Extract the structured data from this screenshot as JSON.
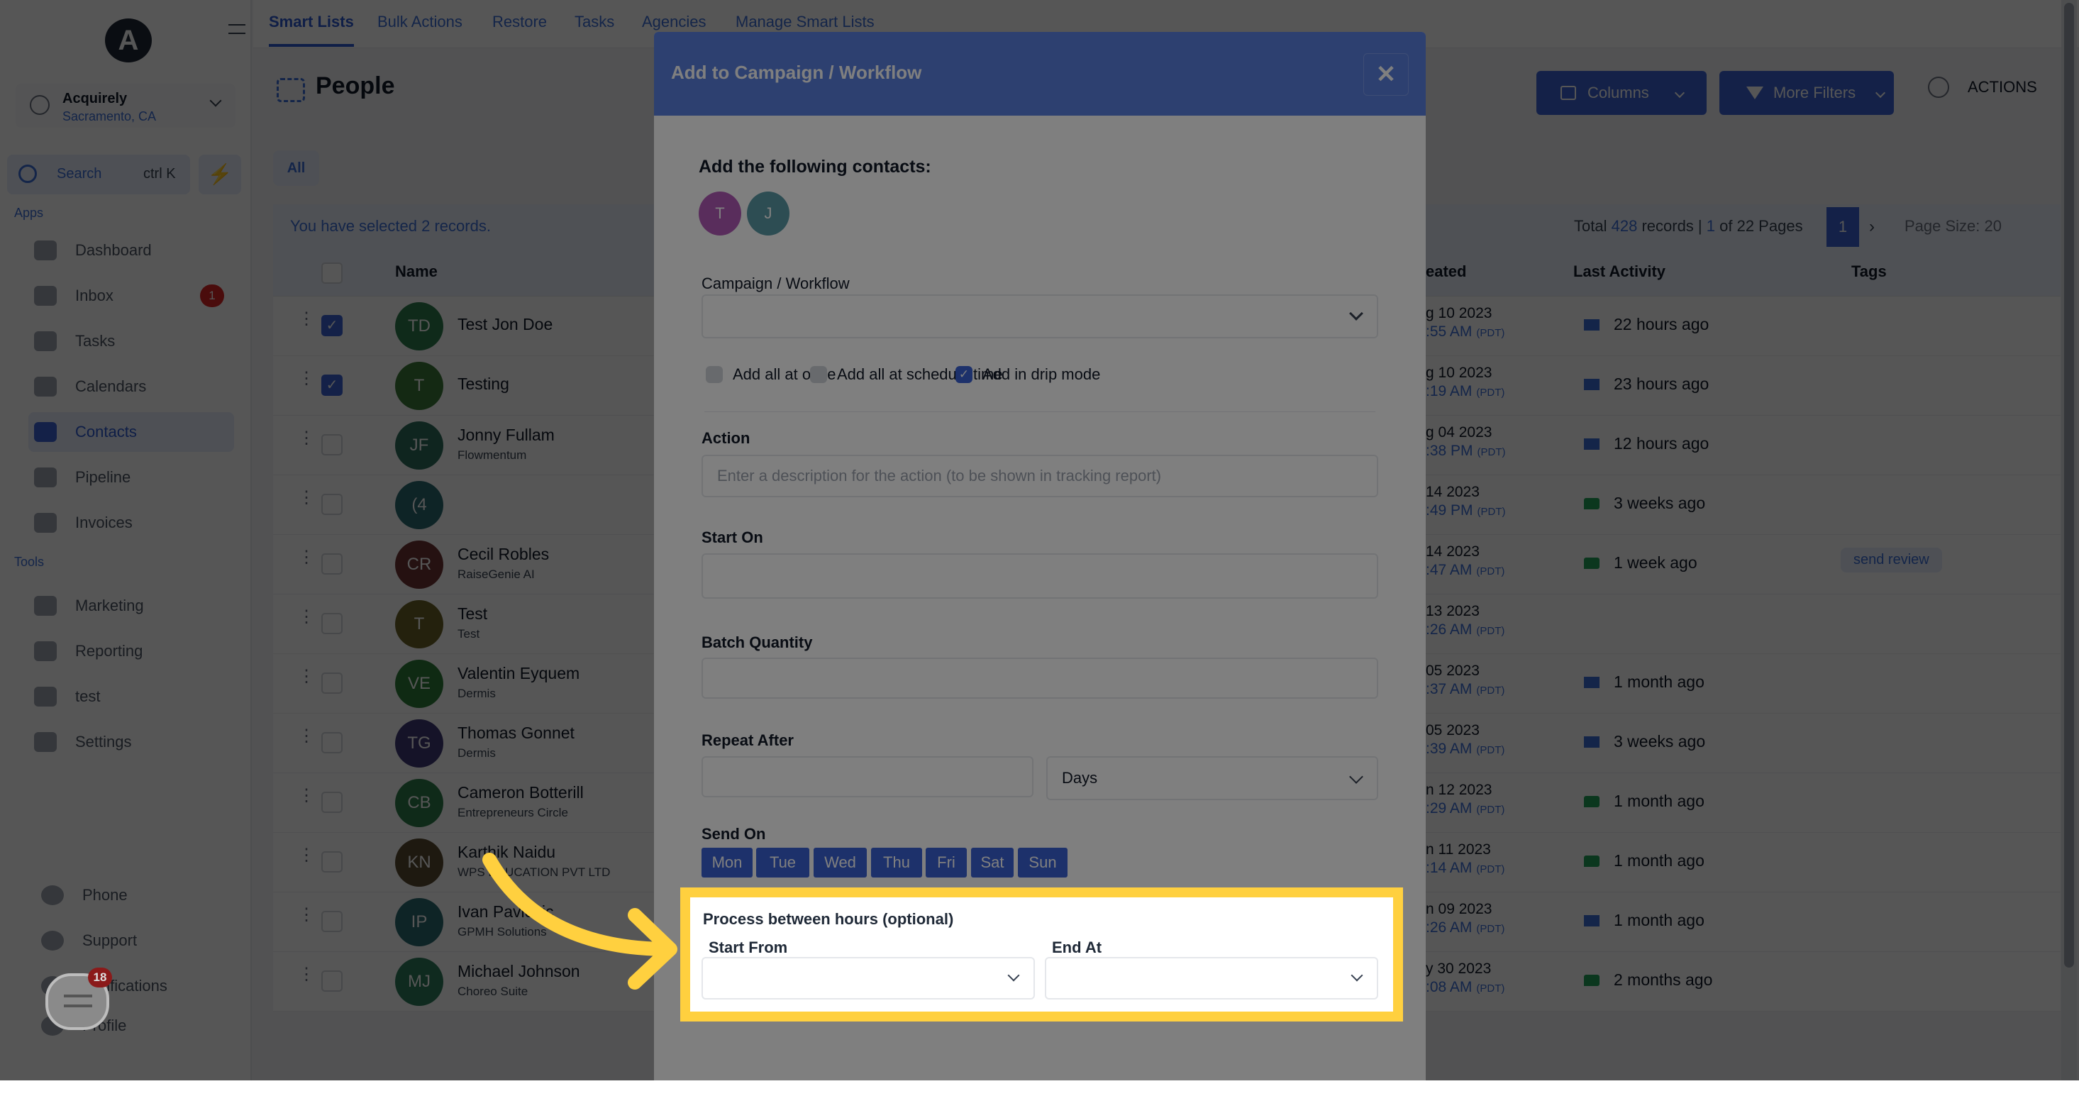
{
  "app": {
    "account": {
      "name": "Acquirely",
      "location": "Sacramento, CA"
    },
    "search": {
      "placeholder": "Search",
      "shortcut": "ctrl K"
    },
    "sidebar": {
      "apps_label": "Apps",
      "tools_label": "Tools",
      "items": [
        {
          "label": "Dashboard",
          "icon": "dashboard-icon"
        },
        {
          "label": "Inbox",
          "icon": "inbox-icon",
          "badge": "1"
        },
        {
          "label": "Tasks",
          "icon": "tasks-icon"
        },
        {
          "label": "Calendars",
          "icon": "calendar-icon"
        },
        {
          "label": "Contacts",
          "icon": "contacts-icon",
          "active": true
        },
        {
          "label": "Pipeline",
          "icon": "pipeline-icon"
        },
        {
          "label": "Invoices",
          "icon": "invoice-icon"
        }
      ],
      "tools": [
        {
          "label": "Marketing",
          "icon": "megaphone-icon"
        },
        {
          "label": "Reporting",
          "icon": "chart-icon"
        },
        {
          "label": "test",
          "icon": "accessibility-icon"
        },
        {
          "label": "Settings",
          "icon": "gear-icon"
        }
      ],
      "bottom": [
        {
          "label": "Phone",
          "icon": "phone-icon"
        },
        {
          "label": "Support",
          "icon": "support-icon"
        },
        {
          "label": "Notifications",
          "icon": "bell-icon"
        },
        {
          "label": "Profile",
          "icon": "profile-icon"
        }
      ],
      "chat_badge": "18"
    },
    "tabs": [
      "Smart Lists",
      "Bulk Actions",
      "Restore",
      "Tasks",
      "Agencies",
      "Manage Smart Lists"
    ],
    "page_title": "People",
    "filter_chip": "All",
    "toolbar": {
      "columns": "Columns",
      "more_filters": "More Filters",
      "actions": "ACTIONS"
    },
    "selection_text": "You have selected 2 records.",
    "pagination": {
      "total_prefix": "Total",
      "total": "428",
      "records_label": "records |",
      "page": "1",
      "of_pages": "of 22 Pages",
      "current_page": "1",
      "page_size": "Page Size: 20"
    },
    "columns": {
      "name": "Name",
      "created": "eated",
      "last_activity": "Last Activity",
      "tags": "Tags"
    },
    "rows": [
      {
        "initials": "TD",
        "color": "#2e7d4f",
        "name": "Test Jon Doe",
        "sub": "",
        "date": "g 10 2023",
        "time": ":55 AM",
        "activity_type": "email",
        "activity": "22 hours ago",
        "checked": true
      },
      {
        "initials": "T",
        "color": "#3d7a3a",
        "name": "Testing",
        "sub": "",
        "date": "g 10 2023",
        "time": ":19 AM",
        "activity_type": "email",
        "activity": "23 hours ago",
        "checked": true
      },
      {
        "initials": "JF",
        "color": "#2d6e5e",
        "name": "Jonny Fullam",
        "sub": "Flowmentum",
        "date": "g 04 2023",
        "time": ":38 PM",
        "activity_type": "email",
        "activity": "12 hours ago"
      },
      {
        "initials": "(4",
        "color": "#2b6a70",
        "name": "",
        "sub": "",
        "date": " 14 2023",
        "time": ":49 PM",
        "activity_type": "sms",
        "activity": "3 weeks ago"
      },
      {
        "initials": "CR",
        "color": "#6e3434",
        "name": "Cecil Robles",
        "sub": "RaiseGenie AI",
        "date": " 14 2023",
        "time": ":47 AM",
        "activity_type": "sms",
        "activity": "1 week ago",
        "tag": "send review"
      },
      {
        "initials": "T",
        "color": "#6a6227",
        "name": "Test",
        "sub": "Test",
        "date": " 13 2023",
        "time": ":26 AM",
        "activity_type": "",
        "activity": ""
      },
      {
        "initials": "VE",
        "color": "#2e7d3a",
        "name": "Valentin Eyquem",
        "sub": "Dermis",
        "date": " 05 2023",
        "time": ":37 AM",
        "activity_type": "email",
        "activity": "1 month ago"
      },
      {
        "initials": "TG",
        "color": "#3f3a78",
        "name": "Thomas Gonnet",
        "sub": "Dermis",
        "date": " 05 2023",
        "time": ":39 AM",
        "activity_type": "email",
        "activity": "3 weeks ago"
      },
      {
        "initials": "CB",
        "color": "#2e7d4a",
        "name": "Cameron Botterill",
        "sub": "Entrepreneurs Circle",
        "date": "n 12 2023",
        "time": ":29 AM",
        "activity_type": "sms",
        "activity": "1 month ago"
      },
      {
        "initials": "KN",
        "color": "#5a4a30",
        "name": "Karthik Naidu",
        "sub": "WPS EDUCATION PVT LTD",
        "date": "n 11 2023",
        "time": ":14 AM",
        "activity_type": "sms",
        "activity": "1 month ago"
      },
      {
        "initials": "IP",
        "color": "#2b6a70",
        "name": "Ivan Pavlovic",
        "sub": "GPMH Solutions",
        "date": "n 09 2023",
        "time": ":26 AM",
        "activity_type": "email",
        "activity": "1 month ago"
      },
      {
        "initials": "MJ",
        "color": "#2e7d5e",
        "name": "Michael Johnson",
        "sub": "Choreo Suite",
        "date": "y 30 2023",
        "time": ":08 AM",
        "activity_type": "sms",
        "activity": "2 months ago"
      }
    ],
    "timezone": "(PDT)"
  },
  "modal": {
    "title": "Add to Campaign / Workflow",
    "contacts_heading": "Add the following contacts:",
    "contacts": [
      {
        "initial": "T",
        "color": "#b35bb8"
      },
      {
        "initial": "J",
        "color": "#5b9aa6"
      }
    ],
    "campaign_label": "Campaign / Workflow",
    "campaign_value": "",
    "options": [
      {
        "label": "Add all at once",
        "checked": false
      },
      {
        "label": "Add all at schedule time",
        "checked": false
      },
      {
        "label": "Add in drip mode",
        "checked": true
      }
    ],
    "action_label": "Action",
    "action_placeholder": "Enter a description for the action (to be shown in tracking report)",
    "start_on_label": "Start On",
    "batch_label": "Batch Quantity",
    "repeat_label": "Repeat After",
    "repeat_unit": "Days",
    "send_on_label": "Send On",
    "days": [
      "Mon",
      "Tue",
      "Wed",
      "Thu",
      "Fri",
      "Sat",
      "Sun"
    ],
    "hours_label": "Process between hours (optional)",
    "start_from_label": "Start From",
    "end_at_label": "End At"
  },
  "colors": {
    "accent": "#3b63d6",
    "modal_header": "#5b80e0",
    "highlight": "#ffd03f"
  }
}
